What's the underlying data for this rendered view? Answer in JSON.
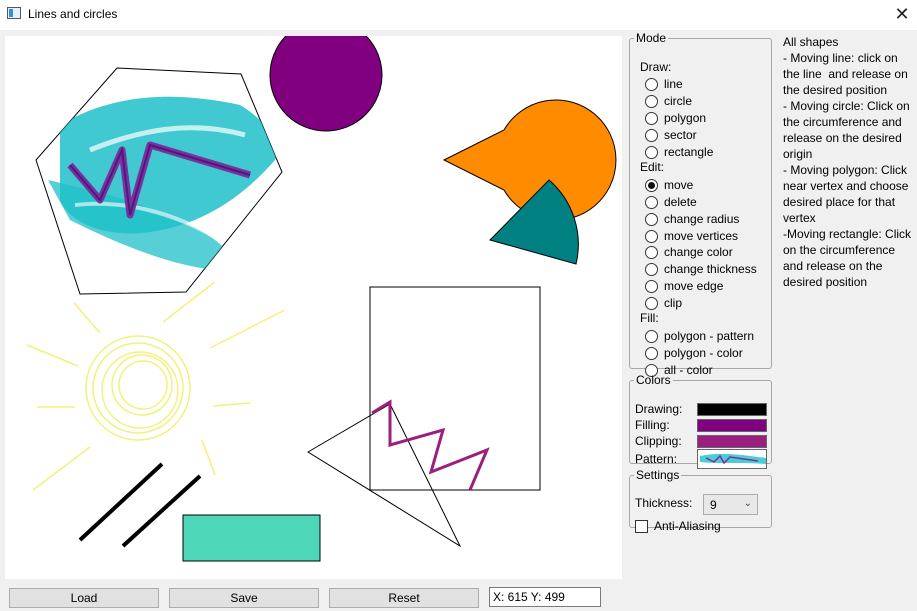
{
  "window": {
    "title": "Lines and circles",
    "close_glyph": "✕"
  },
  "mode": {
    "legend": "Mode",
    "draw_label": "Draw:",
    "draw_options": [
      "line",
      "circle",
      "polygon",
      "sector",
      "rectangle"
    ],
    "edit_label": "Edit:",
    "edit_options": [
      "move",
      "delete",
      "change radius",
      "move vertices",
      "change color",
      "change thickness",
      "move edge",
      "clip"
    ],
    "fill_label": "Fill:",
    "fill_options": [
      "polygon - pattern",
      "polygon - color",
      "all - color"
    ],
    "selected": "move"
  },
  "colors": {
    "legend": "Colors",
    "drawing_label": "Drawing:",
    "filling_label": "Filling:",
    "clipping_label": "Clipping:",
    "pattern_label": "Pattern:",
    "drawing_color": "#000000",
    "filling_color": "#800080",
    "clipping_color": "#9b1f7e"
  },
  "settings": {
    "legend": "Settings",
    "thickness_label": "Thickness:",
    "thickness_value": "9",
    "antialiasing_label": "Anti-Aliasing",
    "antialiasing_checked": false
  },
  "info": {
    "heading": "All shapes",
    "moving_line": "- Moving line: click on the line  and release on the desired position",
    "moving_circle": "- Moving circle: Click on the circumference and release on the desired origin",
    "moving_polygon": "- Moving polygon: Click near vertex and choose desired place for that vertex",
    "moving_rectangle": "-Moving rectangle: Click on the circumference and release on the desired position"
  },
  "buttons": {
    "load": "Load",
    "save": "Save",
    "reset": "Reset"
  },
  "status": {
    "coordinates": "X: 615 Y: 499"
  },
  "canvas_colors": {
    "purple_circle": "#800080",
    "orange_pacman": "#ff8c00",
    "teal_sector": "#008080",
    "pattern_cyan": "#1ec0c8",
    "pattern_purple": "#7b2fa0",
    "sun_yellow": "#f5f07a",
    "zigzag": "#9b1f7e",
    "mint_rect": "#4dd6b8"
  },
  "icons": {
    "app": "window-app-icon",
    "close": "close-icon",
    "dropdown": "chevron-down-icon"
  }
}
